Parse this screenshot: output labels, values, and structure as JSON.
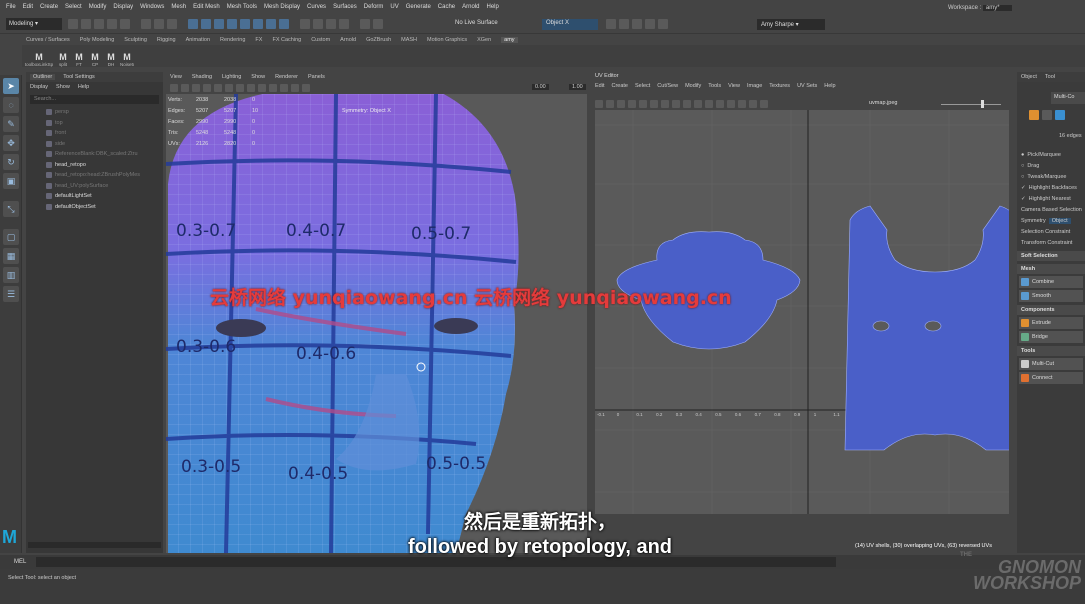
{
  "menu": {
    "items": [
      "File",
      "Edit",
      "Create",
      "Select",
      "Modify",
      "Display",
      "Windows",
      "Mesh",
      "Edit Mesh",
      "Mesh Tools",
      "Mesh Display",
      "Curves",
      "Surfaces",
      "Deform",
      "UV",
      "Generate",
      "Cache",
      "Arnold",
      "Help"
    ],
    "workspace_label": "Workspace :",
    "workspace_value": "amy*"
  },
  "status": {
    "mode": "Modeling",
    "live": "No Live Surface",
    "object": "Object X",
    "user": "Amy Sharpe"
  },
  "shelf": {
    "tabs": [
      "Curves / Surfaces",
      "Poly Modeling",
      "Sculpting",
      "Rigging",
      "Animation",
      "Rendering",
      "FX",
      "FX Caching",
      "Custom",
      "Arnold",
      "GoZBrush",
      "MASH",
      "Motion Graphics",
      "XGen",
      "amy"
    ],
    "active": "amy",
    "buttons": [
      "toolboxLinkSp",
      "split",
      "FT",
      "CP",
      "DH",
      "Noise5"
    ]
  },
  "outliner": {
    "tabs": [
      "Outliner",
      "Tool Settings"
    ],
    "menu": [
      "Display",
      "Show",
      "Help"
    ],
    "search": "Search...",
    "items": [
      {
        "name": "persp",
        "visible": false
      },
      {
        "name": "top",
        "visible": false
      },
      {
        "name": "front",
        "visible": false
      },
      {
        "name": "side",
        "visible": false
      },
      {
        "name": "ReferenceBlank:OBK_scaled:Ztru",
        "visible": false
      },
      {
        "name": "head_retopo",
        "visible": true
      },
      {
        "name": "head_retopo:head:ZBrushPolyMes",
        "visible": false
      },
      {
        "name": "head_UV:polySurface",
        "visible": false
      },
      {
        "name": "defaultLightSet",
        "visible": true
      },
      {
        "name": "defaultObjectSet",
        "visible": true
      }
    ]
  },
  "viewport": {
    "menu": [
      "View",
      "Shading",
      "Lighting",
      "Show",
      "Renderer",
      "Panels"
    ],
    "hud": {
      "rows": [
        [
          "Verts:",
          "2038",
          "2038",
          "0"
        ],
        [
          "Edges:",
          "5207",
          "5207",
          "10"
        ],
        [
          "Faces:",
          "2990",
          "2990",
          "0"
        ],
        [
          "Tris:",
          "5248",
          "5248",
          "0"
        ],
        [
          "UVs:",
          "2126",
          "2820",
          "0"
        ]
      ],
      "symmetry": "Symmetry: Object X"
    },
    "exposure": "0.00",
    "gamma": "1.00",
    "labels": [
      "0.3-0.7",
      "0.4-0.7",
      "0.5-0.7",
      "0.3-0.6",
      "0.4-0.6",
      "0.3-0.5",
      "0.4-0.5",
      "0.5-0.5"
    ]
  },
  "uv_editor": {
    "title": "UV Editor",
    "menu": [
      "Edit",
      "Create",
      "Select",
      "Cut/Sew",
      "Modify",
      "Tools",
      "View",
      "Image",
      "Textures",
      "UV Sets",
      "Help"
    ],
    "texture": "uvmap.jpeg",
    "xticks": [
      "-0.1",
      "0",
      "0.1",
      "0.2",
      "0.3",
      "0.4",
      "0.5",
      "0.6",
      "0.7",
      "0.8",
      "0.9",
      "1",
      "1.1",
      "1.2",
      "1.3",
      "1.4",
      "1.5",
      "1.6",
      "1.7",
      "1.8",
      "1.9"
    ],
    "status": "(14) UV shells, (30) overlapping UVs, (63) reversed UVs"
  },
  "attr": {
    "tabs": [
      "Object",
      "Tool"
    ],
    "header": "Multi-Co",
    "edges": "16 edges",
    "opts": [
      "Pick/Marquee",
      "Drag",
      "Tweak/Marquee",
      "Highlight Backfaces",
      "Highlight Nearest"
    ],
    "camera": "Camera Based Selection",
    "symmetry": "Symmetry",
    "sym_val": "Object",
    "sel_constraint": "Selection Constraint",
    "transform": "Transform Constraint",
    "sections": {
      "soft": "Soft Selection",
      "mesh": "Mesh",
      "components": "Components",
      "tools": "Tools"
    },
    "buttons": {
      "combine": "Combine",
      "smooth": "Smooth",
      "extrude": "Extrude",
      "bridge": "Bridge",
      "multicut": "Multi-Cut",
      "connect": "Connect"
    }
  },
  "bottom": {
    "mel": "MEL",
    "help": "Select Tool: select an object"
  },
  "subtitle": {
    "cn": "然后是重新拓扑，",
    "en": "followed by retopology, and"
  },
  "watermark": "云桥网络 yunqiaowang.cn 云桥网络 yunqiaowang.cn",
  "logo": {
    "the": "THE",
    "gnomon": "GNOMON",
    "workshop": "WORKSHOP"
  },
  "colors": {
    "accent": "#5a86a8",
    "uv_shell": "#4a5fc8",
    "mesh_purple": "#8a5fd6",
    "mesh_blue": "#3f8ad0",
    "watermark": "#e53b3b"
  }
}
